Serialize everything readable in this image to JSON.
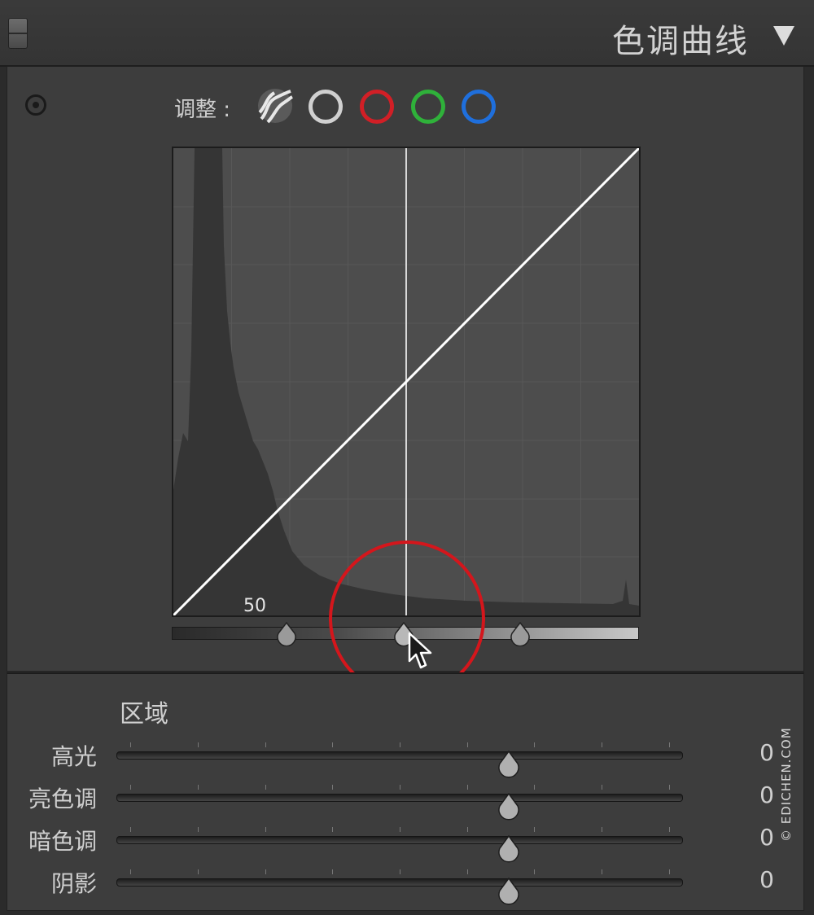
{
  "header": {
    "title": "色调曲线"
  },
  "curve_panel": {
    "adjust_label": "调整 :",
    "channels": [
      {
        "name": "rgb",
        "color": "#d0d0d0"
      },
      {
        "name": "red",
        "color": "#d11f26"
      },
      {
        "name": "green",
        "color": "#2fb13a"
      },
      {
        "name": "blue",
        "color": "#1f6fdc"
      }
    ],
    "point_value": "50",
    "split_points": [
      25,
      50,
      75
    ]
  },
  "region": {
    "title": "区域",
    "sliders": [
      {
        "label": "高光",
        "value": "0"
      },
      {
        "label": "亮色调",
        "value": "0"
      },
      {
        "label": "暗色调",
        "value": "0"
      },
      {
        "label": "阴影",
        "value": "0"
      }
    ]
  },
  "watermark": "© EDICHEN.COM"
}
